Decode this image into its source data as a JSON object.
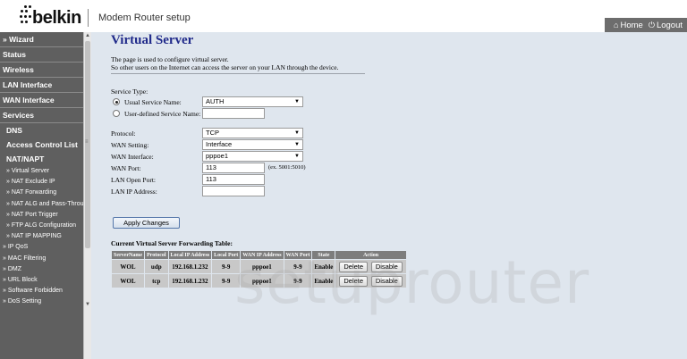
{
  "header": {
    "brand": "belkin",
    "app_title": "Modem Router setup",
    "home_label": "Home",
    "logout_label": "Logout"
  },
  "sidebar": {
    "items": [
      {
        "label": "» Wizard"
      },
      {
        "label": "Status"
      },
      {
        "label": "Wireless"
      },
      {
        "label": "LAN Interface"
      },
      {
        "label": "WAN Interface"
      },
      {
        "label": "Services"
      }
    ],
    "sub_items": [
      {
        "label": "DNS"
      },
      {
        "label": "Access Control List"
      },
      {
        "label": "NAT/NAPT"
      }
    ],
    "nat_children": [
      {
        "label": "» Virtual Server"
      },
      {
        "label": "» NAT Exclude IP"
      },
      {
        "label": "» NAT Forwarding"
      },
      {
        "label": "» NAT ALG and Pass-Through"
      },
      {
        "label": "» NAT Port Trigger"
      },
      {
        "label": "» FTP ALG Configuration"
      },
      {
        "label": "» NAT IP MAPPING"
      }
    ],
    "service_children": [
      {
        "label": "» IP QoS"
      },
      {
        "label": "» MAC Filtering"
      },
      {
        "label": "» DMZ"
      },
      {
        "label": "» URL Block"
      },
      {
        "label": "» Software Forbidden"
      },
      {
        "label": "» DoS Setting"
      }
    ]
  },
  "page": {
    "title": "Virtual Server",
    "desc_line1": "The page is used to configure virtual server.",
    "desc_line2": "So other users on the Internet can access the server on your LAN through the device."
  },
  "form": {
    "service_type_label": "Service Type:",
    "usual_service_label": "Usual Service Name:",
    "usual_service_value": "AUTH",
    "user_defined_label": "User-defined Service Name:",
    "user_defined_value": "",
    "protocol_label": "Protocol:",
    "protocol_value": "TCP",
    "wan_setting_label": "WAN Setting:",
    "wan_setting_value": "Interface",
    "wan_interface_label": "WAN Interface:",
    "wan_interface_value": "pppoe1",
    "wan_port_label": "WAN Port:",
    "wan_port_value": "113",
    "wan_port_hint": "(ex. 5001:5010)",
    "lan_open_port_label": "LAN Open Port:",
    "lan_open_port_value": "113",
    "lan_ip_label": "LAN IP Address:",
    "lan_ip_value": "",
    "apply_label": "Apply Changes"
  },
  "table": {
    "title": "Current Virtual Server Forwarding Table:",
    "headers": [
      "ServerName",
      "Protocol",
      "Local IP Address",
      "Local Port",
      "WAN IP Address",
      "WAN Port",
      "State",
      "Action"
    ],
    "rows": [
      {
        "server": "WOL",
        "protocol": "udp",
        "local_ip": "192.168.1.232",
        "local_port": "9-9",
        "wan_ip": "pppoe1",
        "wan_port": "9-9",
        "state": "Enable",
        "delete": "Delete",
        "disable": "Disable"
      },
      {
        "server": "WOL",
        "protocol": "tcp",
        "local_ip": "192.168.1.232",
        "local_port": "9-9",
        "wan_ip": "pppoe1",
        "wan_port": "9-9",
        "state": "Enable",
        "delete": "Delete",
        "disable": "Disable"
      }
    ]
  },
  "watermark": "setuprouter",
  "colors": {
    "title": "#202a8a",
    "sidebar_bg": "#5f5f5f",
    "content_bg": "#dfe6ee",
    "table_header": "#7d7d7d"
  }
}
